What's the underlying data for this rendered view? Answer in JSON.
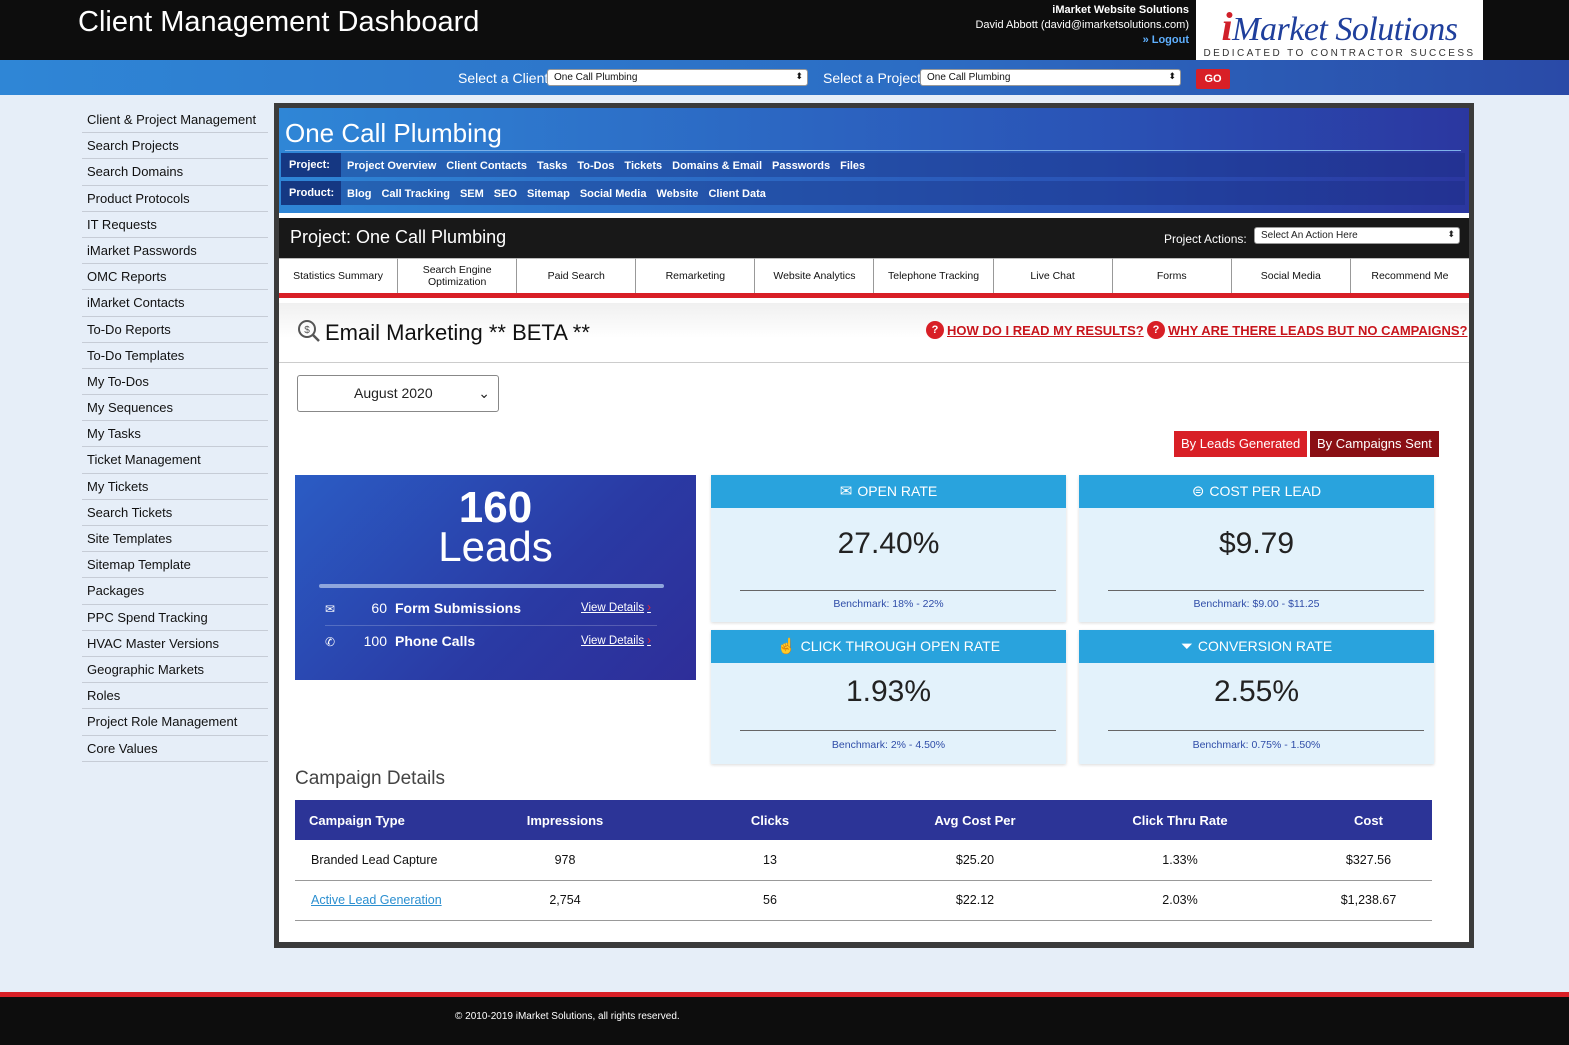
{
  "header": {
    "title": "Client Management Dashboard",
    "org": "iMarket Website Solutions",
    "user": "David Abbott (david@imarketsolutions.com)",
    "logout": "» Logout",
    "logo_i": "i",
    "logo_text": "Market Solutions",
    "logo_tagline": "DEDICATED TO CONTRACTOR SUCCESS"
  },
  "selectors": {
    "client_label": "Select a Client",
    "client_value": "One Call Plumbing",
    "project_label": "Select a Project",
    "project_value": "One Call Plumbing",
    "go": "GO"
  },
  "sidebar": {
    "items": [
      "Client & Project Management",
      "Search Projects",
      "Search Domains",
      "Product Protocols",
      "IT Requests",
      "iMarket Passwords",
      "OMC Reports",
      "iMarket Contacts",
      "To-Do Reports",
      "To-Do Templates",
      "My To-Dos",
      "My Sequences",
      "My Tasks",
      "Ticket Management",
      "My Tickets",
      "Search Tickets",
      "Site Templates",
      "Sitemap Template",
      "Packages",
      "PPC Spend Tracking",
      "HVAC Master Versions",
      "Geographic Markets",
      "Roles",
      "Project Role Management",
      "Core Values"
    ]
  },
  "client": {
    "name": "One Call Plumbing",
    "project_label": "Project:",
    "project_links": [
      "Project Overview",
      "Client Contacts",
      "Tasks",
      "To-Dos",
      "Tickets",
      "Domains & Email",
      "Passwords",
      "Files"
    ],
    "product_label": "Product:",
    "product_links": [
      "Blog",
      "Call Tracking",
      "SEM",
      "SEO",
      "Sitemap",
      "Social Media",
      "Website",
      "Client Data"
    ]
  },
  "project_bar": {
    "title": "Project: One Call Plumbing",
    "actions_label": "Project Actions:",
    "actions_value": "Select An Action Here"
  },
  "tabs": [
    "Statistics Summary",
    "Search Engine Optimization",
    "Paid Search",
    "Remarketing",
    "Website Analytics",
    "Telephone Tracking",
    "Live Chat",
    "Forms",
    "Social Media",
    "Recommend Me"
  ],
  "section": {
    "title": "Email Marketing ** BETA **",
    "help1": "HOW DO I READ MY RESULTS?",
    "help2": "WHY ARE THERE LEADS BUT NO CAMPAIGNS?",
    "month": "August 2020",
    "toggle_leads": "By Leads Generated",
    "toggle_campaigns": "By Campaigns Sent"
  },
  "leads": {
    "total": "160",
    "label": "Leads",
    "rows": [
      {
        "count": "60",
        "name": "Form Submissions",
        "link": "View Details"
      },
      {
        "count": "100",
        "name": "Phone Calls",
        "link": "View Details"
      }
    ]
  },
  "metrics": {
    "open_rate": {
      "title": "OPEN RATE",
      "value": "27.40%",
      "benchmark": "Benchmark: 18% - 22%"
    },
    "cost_per_lead": {
      "title": "COST PER LEAD",
      "value": "$9.79",
      "benchmark": "Benchmark: $9.00 - $11.25"
    },
    "ctor": {
      "title": "CLICK THROUGH OPEN RATE",
      "value": "1.93%",
      "benchmark": "Benchmark: 2% - 4.50%"
    },
    "conversion": {
      "title": "CONVERSION RATE",
      "value": "2.55%",
      "benchmark": "Benchmark: 0.75% - 1.50%"
    }
  },
  "campaigns": {
    "title": "Campaign Details",
    "columns": [
      "Campaign Type",
      "Impressions",
      "Clicks",
      "Avg Cost Per",
      "Click Thru Rate",
      "Cost"
    ],
    "rows": [
      [
        "Branded Lead Capture",
        "978",
        "13",
        "$25.20",
        "1.33%",
        "$327.56"
      ],
      [
        "Active Lead Generation",
        "2,754",
        "56",
        "$22.12",
        "2.03%",
        "$1,238.67"
      ]
    ]
  },
  "footer": {
    "text": "© 2010-2019 iMarket Solutions, all rights reserved."
  },
  "colors": {
    "brand_red": "#d81f26",
    "brand_blue": "#2c3497",
    "metric_blue": "#29a3dd",
    "dark_red": "#8a0f14"
  }
}
